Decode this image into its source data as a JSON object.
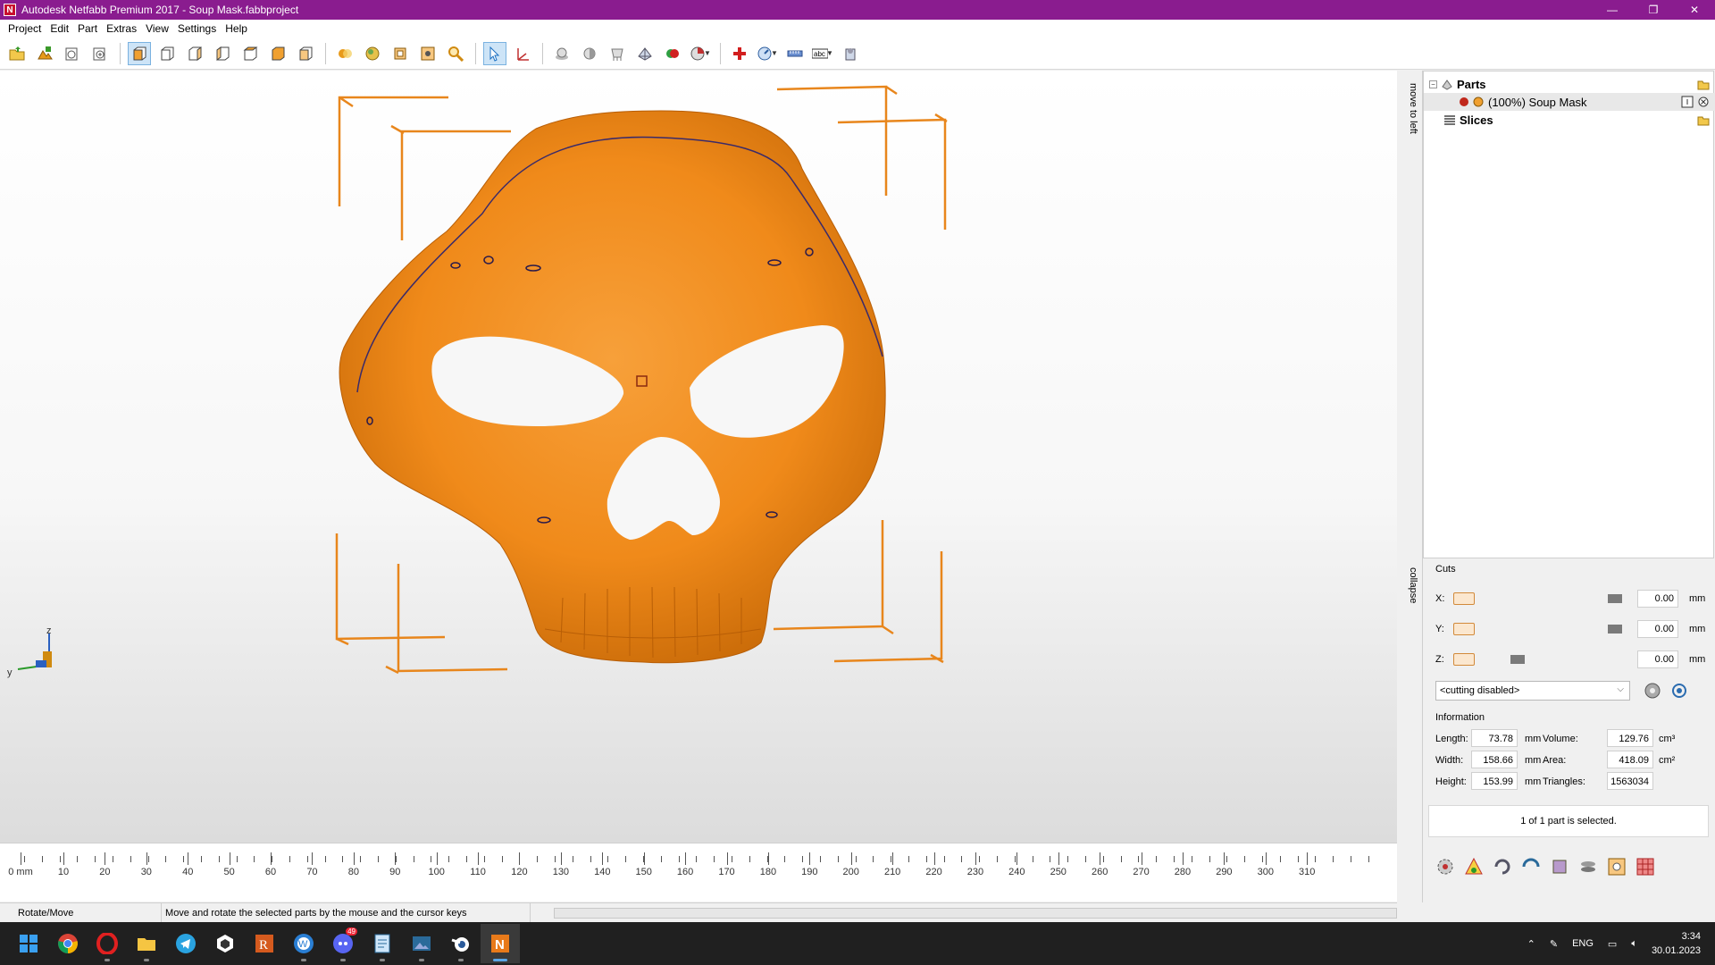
{
  "window": {
    "title": "Autodesk Netfabb Premium 2017 - Soup Mask.fabbproject",
    "icon_letter": "N",
    "buttons": [
      "—",
      "❐",
      "✕"
    ]
  },
  "menu": [
    "Project",
    "Edit",
    "Part",
    "Extras",
    "View",
    "Settings",
    "Help"
  ],
  "toolbar": {
    "icons": [
      "open-project-icon",
      "add-part-icon",
      "new-project-icon",
      "load-icon",
      "view-front-icon",
      "view-back-icon",
      "view-left-icon",
      "view-right-icon",
      "view-top-icon",
      "view-bottom-icon",
      "view-iso-icon",
      "zoom-icon",
      "select-icon",
      "measure-icon",
      "repair-icon",
      "text-icon"
    ]
  },
  "viewport": {
    "axis_labels": {
      "z": "z",
      "y": "y"
    },
    "model_color": "#f08a1a",
    "frame_color": "#e8861c"
  },
  "ruler": {
    "unit_label": "0 mm",
    "ticks": [
      "10",
      "20",
      "30",
      "40",
      "50",
      "60",
      "70",
      "80",
      "90",
      "100",
      "110",
      "120",
      "130",
      "140",
      "150",
      "160",
      "170",
      "180",
      "190",
      "200",
      "210",
      "220",
      "230",
      "240",
      "250",
      "260",
      "270",
      "280",
      "290",
      "300",
      "310"
    ]
  },
  "status": {
    "mode": "Rotate/Move",
    "message": "Move and rotate the selected parts by the mouse and the cursor keys"
  },
  "side_tabs": {
    "top": "move to left",
    "bottom": "collapse"
  },
  "tree": {
    "parts_label": "Parts",
    "part_name": "(100%) Soup Mask",
    "slices_label": "Slices"
  },
  "cuts": {
    "title": "Cuts",
    "rows": [
      {
        "axis": "X:",
        "value": "0.00",
        "unit": "mm",
        "slider": 0.88
      },
      {
        "axis": "Y:",
        "value": "0.00",
        "unit": "mm",
        "slider": 0.88
      },
      {
        "axis": "Z:",
        "value": "0.00",
        "unit": "mm",
        "slider": 0.1
      }
    ],
    "mode": "<cutting disabled>"
  },
  "information": {
    "title": "Information",
    "length_label": "Length:",
    "length": "73.78",
    "length_unit": "mm",
    "width_label": "Width:",
    "width": "158.66",
    "width_unit": "mm",
    "height_label": "Height:",
    "height": "153.99",
    "height_unit": "mm",
    "volume_label": "Volume:",
    "volume": "129.76",
    "volume_unit": "cm³",
    "area_label": "Area:",
    "area": "418.09",
    "area_unit": "cm²",
    "triangles_label": "Triangles:",
    "triangles": "1563034"
  },
  "selection_text": "1 of 1 part is selected.",
  "taskbar": {
    "apps": [
      "windows-start-icon",
      "chrome-icon",
      "opera-icon",
      "file-explorer-icon",
      "telegram-icon",
      "app-icon",
      "revit-icon",
      "app-w-icon",
      "discord-icon",
      "notepad-icon",
      "image-viewer-icon",
      "blender-icon",
      "netfabb-icon"
    ],
    "discord_badge": "49",
    "lang": "ENG",
    "time": "3:34",
    "date": "30.01.2023"
  }
}
